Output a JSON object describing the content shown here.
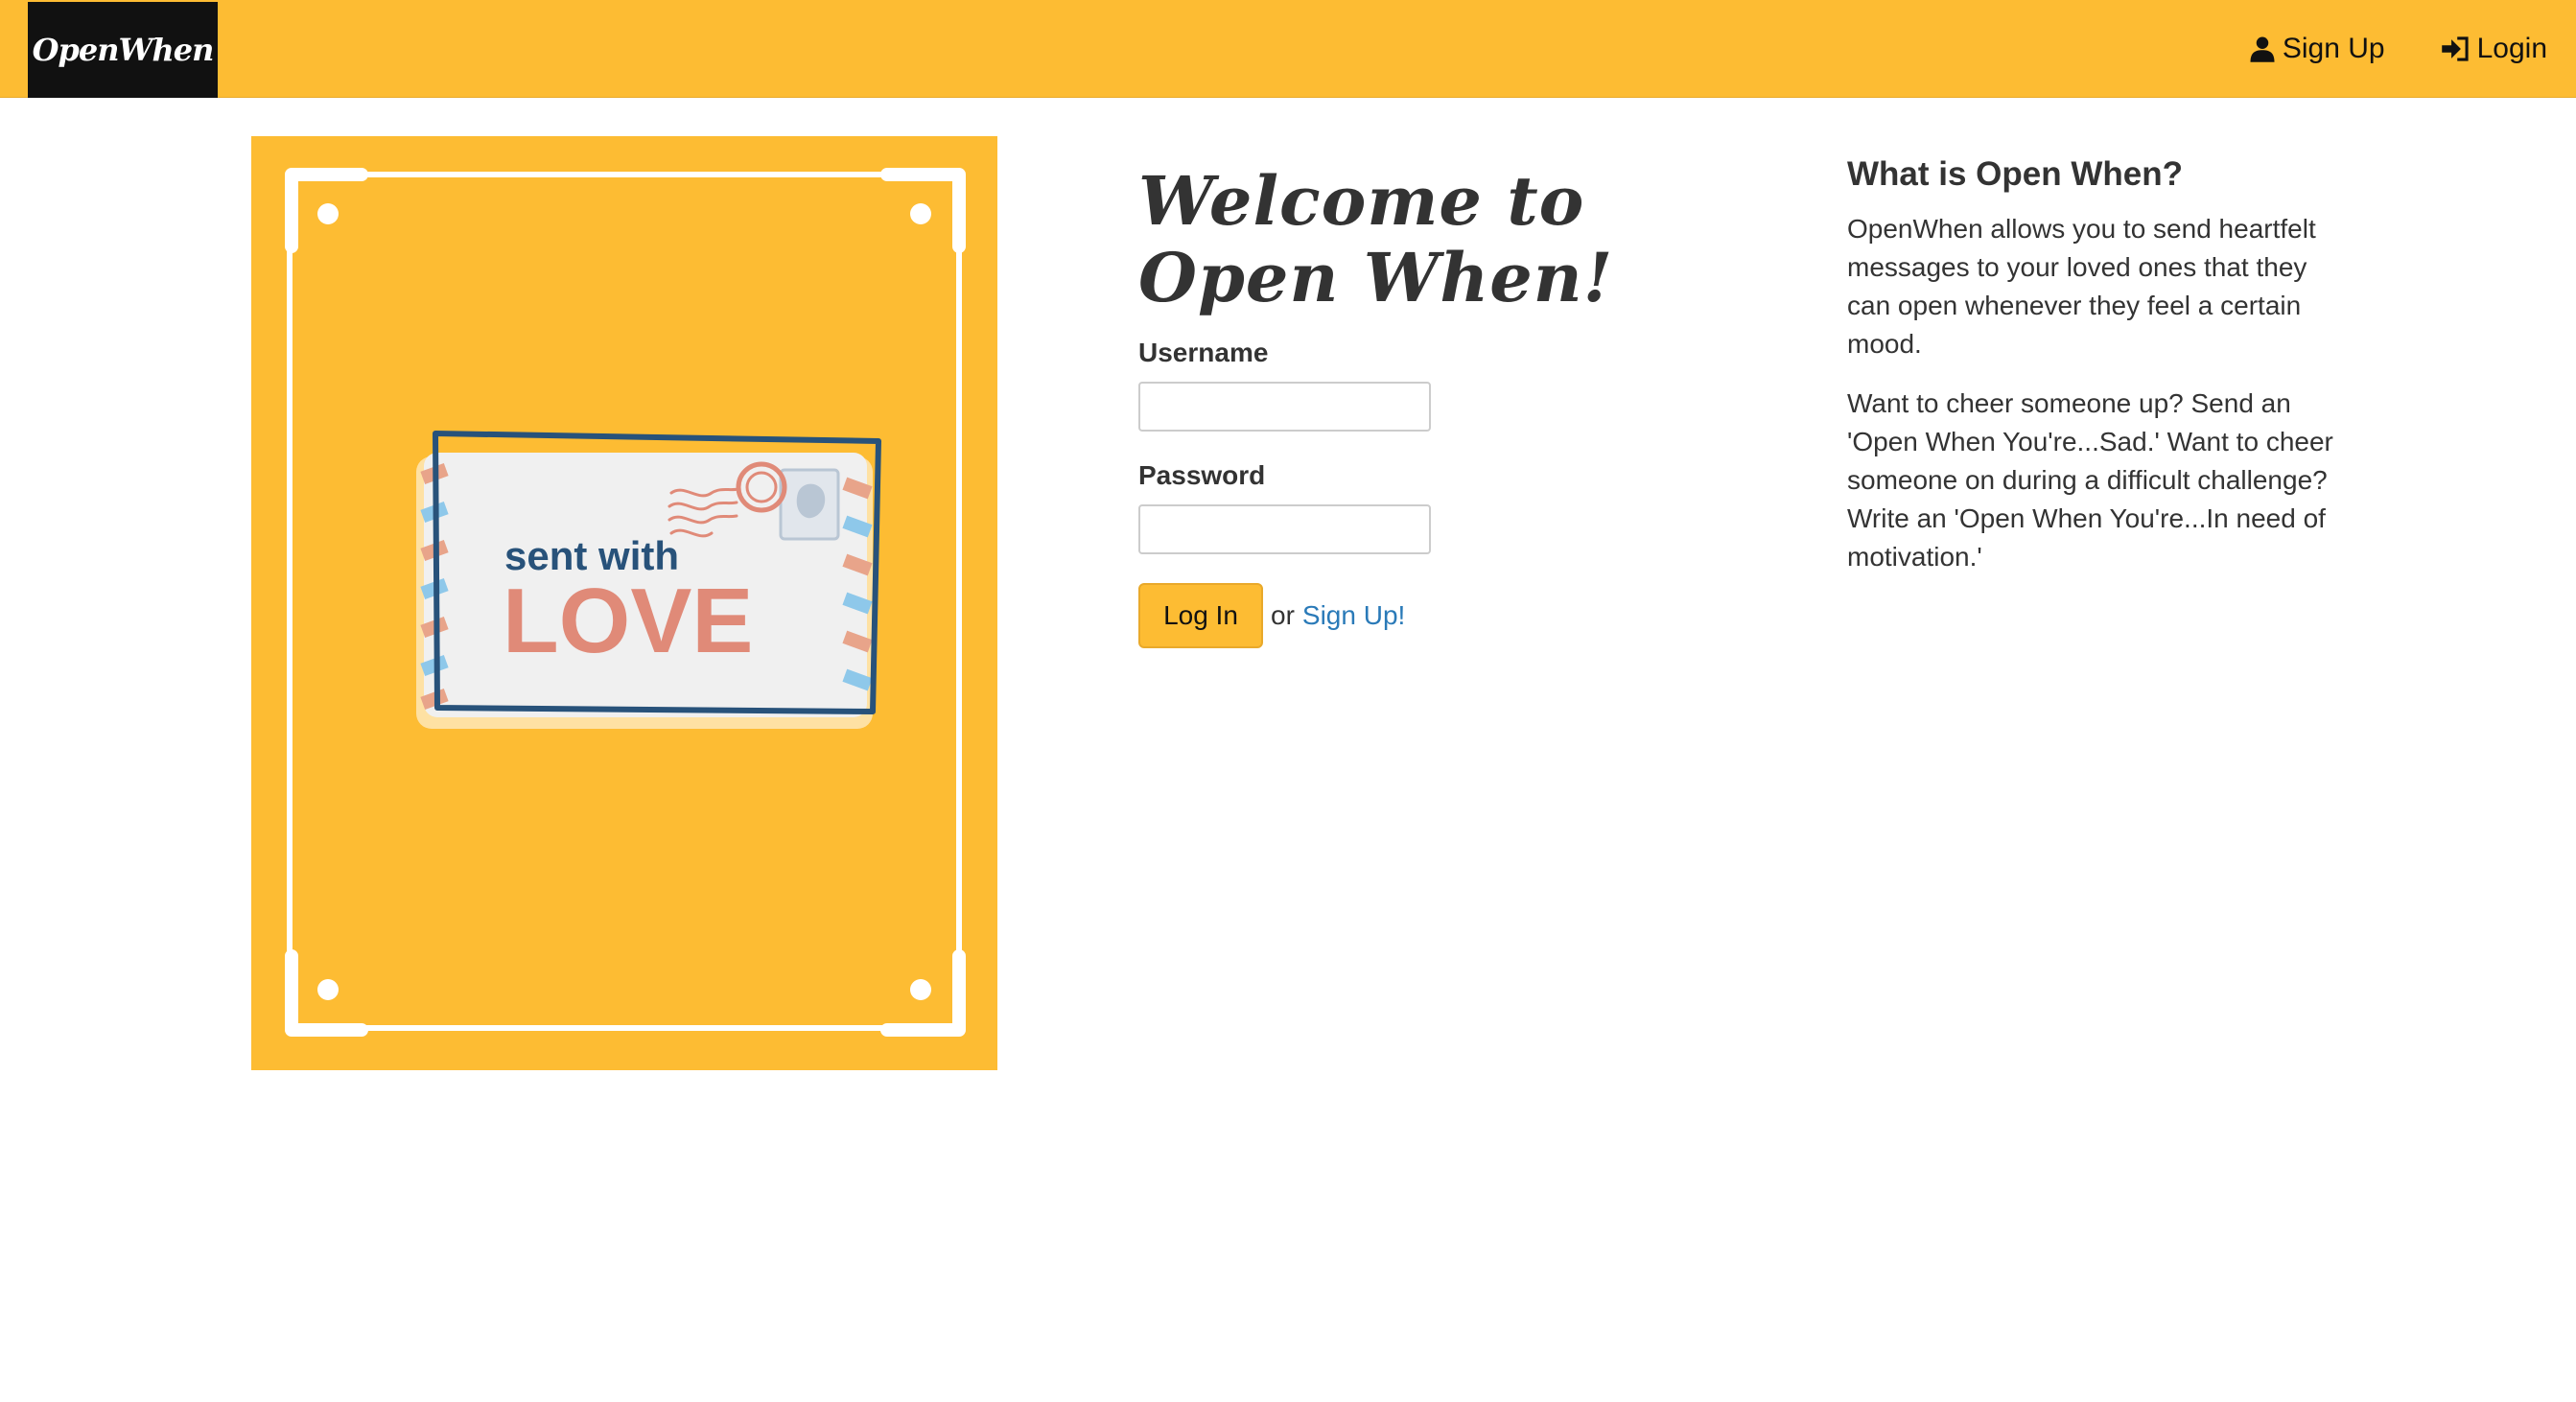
{
  "colors": {
    "brand_yellow": "#fdbc33",
    "brand_black": "#111111",
    "link_blue": "#2a7ab8",
    "text_dark": "#333333"
  },
  "navbar": {
    "brand": "OpenWhen",
    "signup_label": "Sign Up",
    "signup_icon": "user-icon",
    "login_label": "Login",
    "login_icon": "sign-in-icon"
  },
  "hero": {
    "caption_small": "sent with",
    "caption_large": "LOVE",
    "image_name": "envelope-stamp-illustration"
  },
  "login": {
    "title": "Welcome to Open When!",
    "username_label": "Username",
    "username_value": "",
    "password_label": "Password",
    "password_value": "",
    "submit_label": "Log In",
    "or_text": "or",
    "signup_link": "Sign Up!"
  },
  "about": {
    "title": "What is Open When?",
    "paragraphs": [
      "OpenWhen allows you to send heartfelt messages to your loved ones that they can open whenever they feel a certain mood.",
      "Want to cheer someone up? Send an 'Open When You're...Sad.' Want to cheer someone on during a difficult challenge? Write an 'Open When You're...In need of motivation.'"
    ]
  }
}
